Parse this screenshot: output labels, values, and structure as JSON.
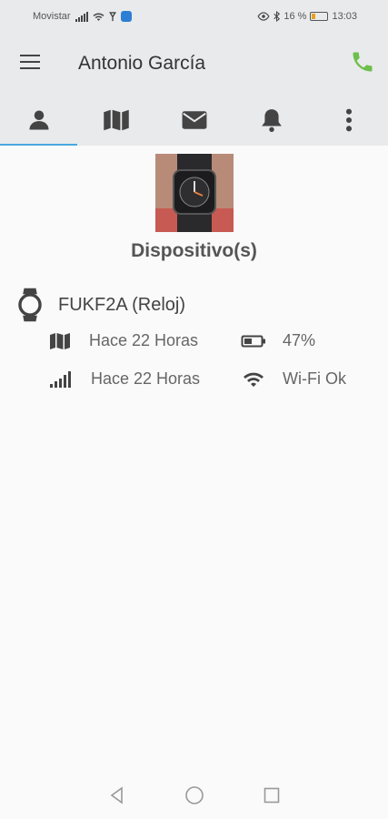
{
  "status": {
    "carrier": "Movistar",
    "battery_percent": "16 %",
    "time": "13:03"
  },
  "header": {
    "title": "Antonio García"
  },
  "tabs": [
    {
      "icon": "person-icon",
      "active": true
    },
    {
      "icon": "map-icon",
      "active": false
    },
    {
      "icon": "mail-icon",
      "active": false
    },
    {
      "icon": "bell-icon",
      "active": false
    },
    {
      "icon": "more-vert-icon",
      "active": false
    }
  ],
  "device": {
    "section_title": "Dispositivo(s)",
    "name": "FUKF2A (Reloj)",
    "location_time": "Hace 22 Horas",
    "battery": "47%",
    "signal_time": "Hace 22 Horas",
    "wifi": "Wi-Fi Ok"
  },
  "colors": {
    "accent": "#4aa8e0",
    "call": "#6cbf4b",
    "bar": "#e9eaec"
  }
}
